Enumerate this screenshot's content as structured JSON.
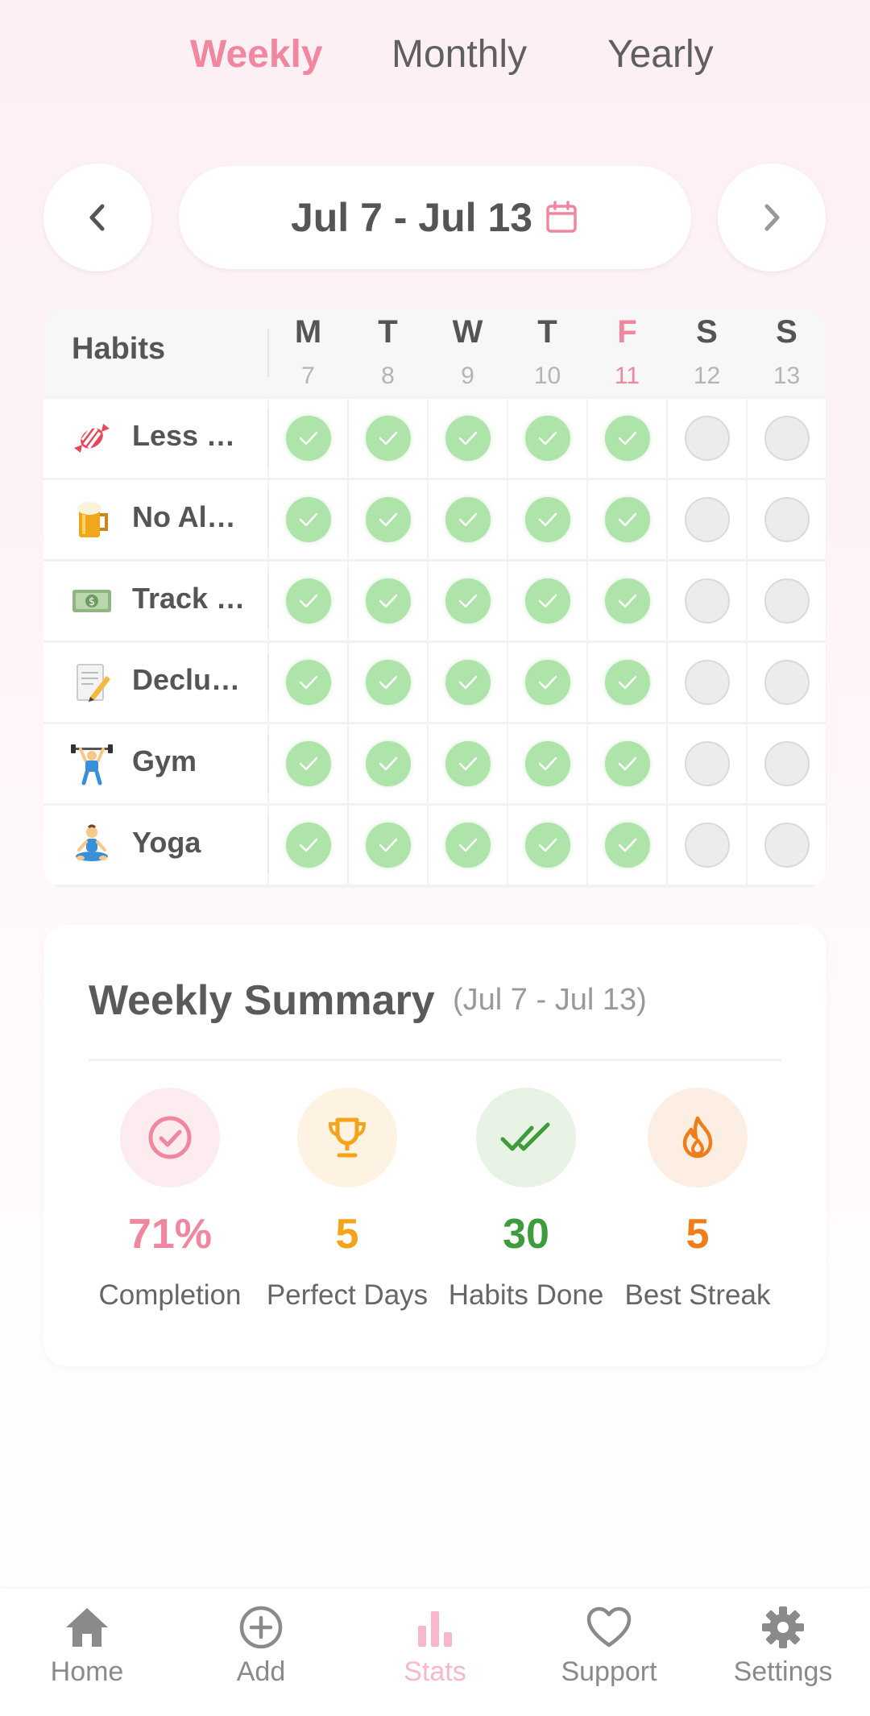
{
  "tabs": {
    "weekly": "Weekly",
    "monthly": "Monthly",
    "yearly": "Yearly",
    "active": "Weekly"
  },
  "date_range": "Jul 7 - Jul 13",
  "table": {
    "header": "Habits",
    "days": [
      {
        "letter": "M",
        "num": "7"
      },
      {
        "letter": "T",
        "num": "8"
      },
      {
        "letter": "W",
        "num": "9"
      },
      {
        "letter": "T",
        "num": "10"
      },
      {
        "letter": "F",
        "num": "11"
      },
      {
        "letter": "S",
        "num": "12"
      },
      {
        "letter": "S",
        "num": "13"
      }
    ],
    "today_index": 4,
    "habits": [
      {
        "emoji": "candy-icon",
        "name": "Less …",
        "done": [
          true,
          true,
          true,
          true,
          true,
          false,
          false
        ]
      },
      {
        "emoji": "beer-mug-icon",
        "name": "No Al…",
        "done": [
          true,
          true,
          true,
          true,
          true,
          false,
          false
        ]
      },
      {
        "emoji": "dollar-banknote-icon",
        "name": "Track …",
        "done": [
          true,
          true,
          true,
          true,
          true,
          false,
          false
        ]
      },
      {
        "emoji": "memo-pencil-icon",
        "name": "Declu…",
        "done": [
          true,
          true,
          true,
          true,
          true,
          false,
          false
        ]
      },
      {
        "emoji": "weightlifter-icon",
        "name": "Gym",
        "done": [
          true,
          true,
          true,
          true,
          true,
          false,
          false
        ]
      },
      {
        "emoji": "yoga-person-icon",
        "name": "Yoga",
        "done": [
          true,
          true,
          true,
          true,
          true,
          false,
          false
        ]
      }
    ]
  },
  "summary": {
    "title": "Weekly Summary",
    "range": "(Jul 7 - Jul 13)",
    "stats": [
      {
        "icon": "check-circle-icon",
        "value": "71%",
        "label": "Completion",
        "color": "#f0879f",
        "bg": "#fdecef"
      },
      {
        "icon": "trophy-icon",
        "value": "5",
        "label": "Perfect Days",
        "color": "#f5a31a",
        "bg": "#fef2e2"
      },
      {
        "icon": "double-check-icon",
        "value": "30",
        "label": "Habits Done",
        "color": "#3f9c3c",
        "bg": "#e8f3e6"
      },
      {
        "icon": "flame-icon",
        "value": "5",
        "label": "Best Streak",
        "color": "#ef7d1a",
        "bg": "#fdeee4"
      }
    ]
  },
  "bottom_nav": {
    "items": [
      {
        "label": "Home",
        "icon": "home-icon"
      },
      {
        "label": "Add",
        "icon": "add-circle-icon"
      },
      {
        "label": "Stats",
        "icon": "bar-chart-icon"
      },
      {
        "label": "Support",
        "icon": "heart-icon"
      },
      {
        "label": "Settings",
        "icon": "gear-icon"
      }
    ],
    "active": "Stats"
  },
  "colors": {
    "accent": "#f0879f",
    "done": "#aee4a9",
    "todo": "#ececec"
  }
}
